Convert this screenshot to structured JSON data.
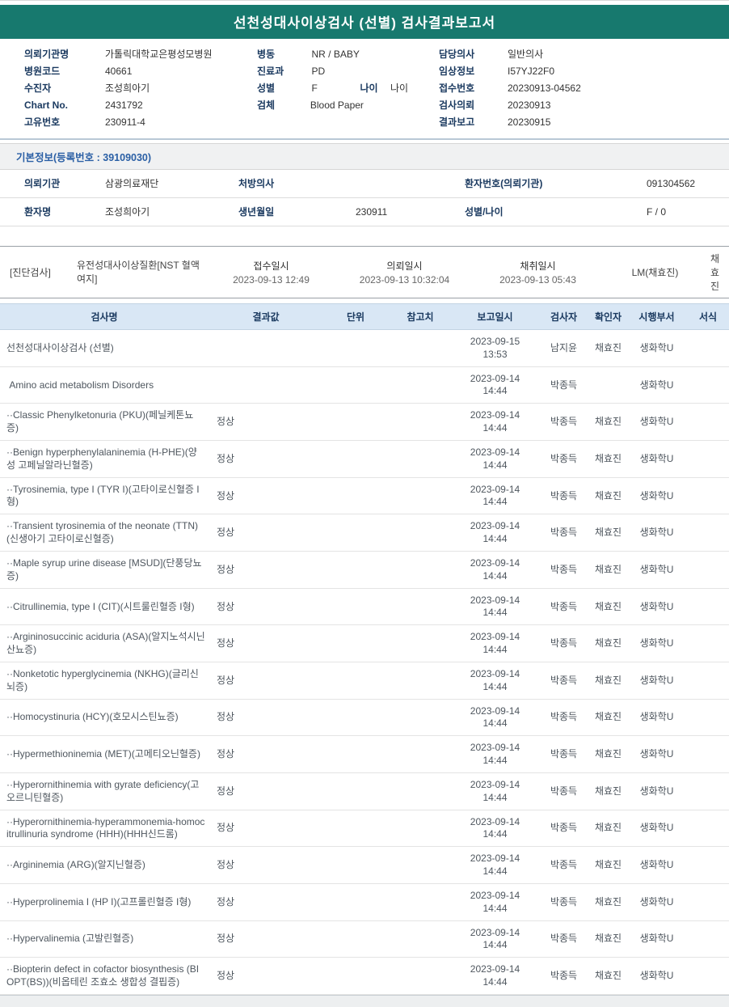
{
  "colors": {
    "accent_teal": "#17796E",
    "table_header_bg": "#D9E7F5",
    "label_navy": "#1B3A60",
    "section_blue": "#2A5FA5"
  },
  "title": "선천성대사이상검사 (선별) 검사결과보고서",
  "header_info": {
    "col1": [
      {
        "label": "의뢰기관명",
        "value": "가톨릭대학교은평성모병원"
      },
      {
        "label": "병원코드",
        "value": "40661"
      },
      {
        "label": "수진자",
        "value": "조성희아기"
      },
      {
        "label": "Chart No.",
        "value": "2431792"
      },
      {
        "label": "고유번호",
        "value": "230911-4"
      }
    ],
    "col2": [
      {
        "label": "병동",
        "value": "NR / BABY"
      },
      {
        "label": "진료과",
        "value": "PD"
      },
      {
        "label": "성별",
        "value": "F",
        "label2": "나이",
        "value2": "나이"
      },
      {
        "label": "검체",
        "value": "Blood Paper"
      }
    ],
    "col3": [
      {
        "label": "담당의사",
        "value": "일반의사"
      },
      {
        "label": "임상정보",
        "value": "I57YJ22F0"
      },
      {
        "label": "접수번호",
        "value": "20230913-04562"
      },
      {
        "label": "검사의뢰",
        "value": "20230913"
      },
      {
        "label": "결과보고",
        "value": "20230915"
      }
    ]
  },
  "basic_info": {
    "section_title": "기본정보(등록번호 : 39109030)",
    "rows": [
      [
        {
          "label": "의뢰기관",
          "value": "삼광의료재단"
        },
        {
          "label": "처방의사",
          "value": ""
        },
        {
          "label": "환자번호(의뢰기관)",
          "value": "091304562"
        }
      ],
      [
        {
          "label": "환자명",
          "value": "조성희아기"
        },
        {
          "label": "생년월일",
          "value": "230911"
        },
        {
          "label": "성별/나이",
          "value": "F / 0"
        }
      ]
    ]
  },
  "diagnosis": {
    "tag": "[진단검사]",
    "test_group": "유전성대사이상질환[NST 혈액여지]",
    "receipt_label": "접수일시",
    "receipt_time": "2023-09-13 12:49",
    "request_label": "의뢰일시",
    "request_time": "2023-09-13 10:32:04",
    "collect_label": "채취일시",
    "collect_time": "2023-09-13 05:43",
    "collector": "LM(채효진)",
    "confirmer": "채효진"
  },
  "results": {
    "headers": [
      "검사명",
      "결과값",
      "단위",
      "참고치",
      "보고일시",
      "검사자",
      "확인자",
      "시행부서",
      "서식"
    ],
    "rows": [
      {
        "name": "선천성대사이상검사 (선별)",
        "result": "",
        "unit": "",
        "ref": "",
        "reported": "2023-09-15\n13:53",
        "tester": "남지윤",
        "confirmer": "채효진",
        "dept": "생화학U",
        "format": ""
      },
      {
        "name": " Amino acid metabolism Disorders",
        "result": "",
        "unit": "",
        "ref": "",
        "reported": "2023-09-14\n14:44",
        "tester": "박종득",
        "confirmer": "",
        "dept": "생화학U",
        "format": ""
      },
      {
        "name": "··Classic Phenylketonuria (PKU)(페닐케톤뇨증)",
        "result": "정상",
        "unit": "",
        "ref": "",
        "reported": "2023-09-14\n14:44",
        "tester": "박종득",
        "confirmer": "채효진",
        "dept": "생화학U",
        "format": ""
      },
      {
        "name": "··Benign hyperphenylalaninemia (H-PHE)(양성 고페닐알라닌혈증)",
        "result": "정상",
        "unit": "",
        "ref": "",
        "reported": "2023-09-14\n14:44",
        "tester": "박종득",
        "confirmer": "채효진",
        "dept": "생화학U",
        "format": ""
      },
      {
        "name": "··Tyrosinemia, type I (TYR I)(고타이로신혈증 I형)",
        "result": "정상",
        "unit": "",
        "ref": "",
        "reported": "2023-09-14\n14:44",
        "tester": "박종득",
        "confirmer": "채효진",
        "dept": "생화학U",
        "format": ""
      },
      {
        "name": "··Transient tyrosinemia of the neonate (TTN)(신생아기 고타이로신혈증)",
        "result": "정상",
        "unit": "",
        "ref": "",
        "reported": "2023-09-14\n14:44",
        "tester": "박종득",
        "confirmer": "채효진",
        "dept": "생화학U",
        "format": ""
      },
      {
        "name": "··Maple syrup urine disease [MSUD](단풍당뇨증)",
        "result": "정상",
        "unit": "",
        "ref": "",
        "reported": "2023-09-14\n14:44",
        "tester": "박종득",
        "confirmer": "채효진",
        "dept": "생화학U",
        "format": ""
      },
      {
        "name": "··Citrullinemia, type I (CIT)(시트룰린혈증 I형)",
        "result": "정상",
        "unit": "",
        "ref": "",
        "reported": "2023-09-14\n14:44",
        "tester": "박종득",
        "confirmer": "채효진",
        "dept": "생화학U",
        "format": ""
      },
      {
        "name": "··Argininosuccinic aciduria (ASA)(알지노석시닌산뇨증)",
        "result": "정상",
        "unit": "",
        "ref": "",
        "reported": "2023-09-14\n14:44",
        "tester": "박종득",
        "confirmer": "채효진",
        "dept": "생화학U",
        "format": ""
      },
      {
        "name": "··Nonketotic hyperglycinemia (NKHG)(글리신뇌증)",
        "result": "정상",
        "unit": "",
        "ref": "",
        "reported": "2023-09-14\n14:44",
        "tester": "박종득",
        "confirmer": "채효진",
        "dept": "생화학U",
        "format": ""
      },
      {
        "name": "··Homocystinuria (HCY)(호모시스틴뇨증)",
        "result": "정상",
        "unit": "",
        "ref": "",
        "reported": "2023-09-14\n14:44",
        "tester": "박종득",
        "confirmer": "채효진",
        "dept": "생화학U",
        "format": ""
      },
      {
        "name": "··Hypermethioninemia (MET)(고메티오닌혈증)",
        "result": "정상",
        "unit": "",
        "ref": "",
        "reported": "2023-09-14\n14:44",
        "tester": "박종득",
        "confirmer": "채효진",
        "dept": "생화학U",
        "format": ""
      },
      {
        "name": "··Hyperornithinemia with gyrate deficiency(고오르니틴혈증)",
        "result": "정상",
        "unit": "",
        "ref": "",
        "reported": "2023-09-14\n14:44",
        "tester": "박종득",
        "confirmer": "채효진",
        "dept": "생화학U",
        "format": ""
      },
      {
        "name": "··Hyperornithinemia-hyperammonemia-homocitrullinuria syndrome (HHH)(HHH신드롬)",
        "result": "정상",
        "unit": "",
        "ref": "",
        "reported": "2023-09-14\n14:44",
        "tester": "박종득",
        "confirmer": "채효진",
        "dept": "생화학U",
        "format": ""
      },
      {
        "name": "··Argininemia (ARG)(알지닌혈증)",
        "result": "정상",
        "unit": "",
        "ref": "",
        "reported": "2023-09-14\n14:44",
        "tester": "박종득",
        "confirmer": "채효진",
        "dept": "생화학U",
        "format": ""
      },
      {
        "name": "··Hyperprolinemia I (HP I)(고프롤린혈증 I형)",
        "result": "정상",
        "unit": "",
        "ref": "",
        "reported": "2023-09-14\n14:44",
        "tester": "박종득",
        "confirmer": "채효진",
        "dept": "생화학U",
        "format": ""
      },
      {
        "name": "··Hypervalinemia (고발린혈증)",
        "result": "정상",
        "unit": "",
        "ref": "",
        "reported": "2023-09-14\n14:44",
        "tester": "박종득",
        "confirmer": "채효진",
        "dept": "생화학U",
        "format": ""
      },
      {
        "name": "··Biopterin defect in cofactor biosynthesis (BIOPT(BS))(비옵테린 조효소 생합성 결핍증)",
        "result": "정상",
        "unit": "",
        "ref": "",
        "reported": "2023-09-14\n14:44",
        "tester": "박종득",
        "confirmer": "채효진",
        "dept": "생화학U",
        "format": ""
      }
    ]
  }
}
